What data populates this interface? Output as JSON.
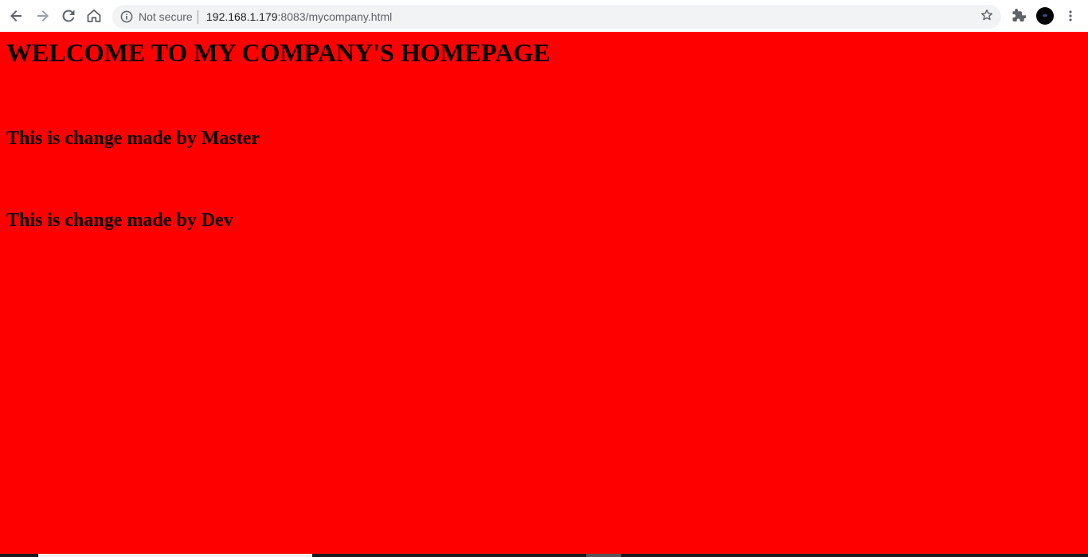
{
  "browser": {
    "security_label": "Not secure",
    "url_host": "192.168.1.179",
    "url_rest": ":8083/mycompany.html",
    "icons": {
      "back": "back-arrow-icon",
      "forward": "forward-arrow-icon",
      "reload": "reload-icon",
      "home": "home-icon",
      "info": "info-icon",
      "bookmark": "star-icon",
      "extensions": "puzzle-icon",
      "menu": "kebab-menu-icon"
    }
  },
  "page": {
    "background_color": "#ff0000",
    "heading": "WELCOME TO MY COMPANY'S HOMEPAGE",
    "changes": [
      "This is change made by Master",
      "This is change made by Dev"
    ]
  }
}
